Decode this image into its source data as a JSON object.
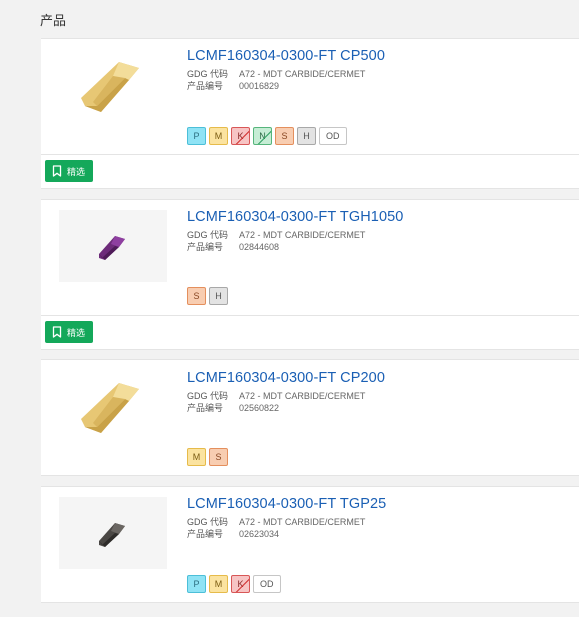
{
  "section": {
    "title": "产品"
  },
  "products": [
    {
      "title": "LCMF160304-0300-FT CP500",
      "gdc_label": "GDG 代码",
      "gdc_value": "A72 - MDT CARBIDE/CERMET",
      "id_label": "产品编号",
      "id_value": "00016829",
      "image": "gold-grooving-insert",
      "badges": [
        {
          "code": "P",
          "slash": false
        },
        {
          "code": "M",
          "slash": false
        },
        {
          "code": "K",
          "slash": true
        },
        {
          "code": "N",
          "slash": true
        },
        {
          "code": "S",
          "slash": false
        },
        {
          "code": "H",
          "slash": false
        },
        {
          "code": "OD",
          "slash": false
        }
      ]
    },
    {
      "title": "LCMF160304-0300-FT TGH1050",
      "gdc_label": "GDG 代码",
      "gdc_value": "A72 - MDT CARBIDE/CERMET",
      "id_label": "产品编号",
      "id_value": "02844608",
      "image": "purple-grooving-insert",
      "badges": [
        {
          "code": "S",
          "slash": false
        },
        {
          "code": "H",
          "slash": false
        }
      ]
    },
    {
      "title": "LCMF160304-0300-FT CP200",
      "gdc_label": "GDG 代码",
      "gdc_value": "A72 - MDT CARBIDE/CERMET",
      "id_label": "产品编号",
      "id_value": "02560822",
      "image": "gold-grooving-insert",
      "badges": [
        {
          "code": "M",
          "slash": false
        },
        {
          "code": "S",
          "slash": false
        }
      ]
    },
    {
      "title": "LCMF160304-0300-FT TGP25",
      "gdc_label": "GDG 代码",
      "gdc_value": "A72 - MDT CARBIDE/CERMET",
      "id_label": "产品编号",
      "id_value": "02623034",
      "image": "dark-grooving-insert",
      "badges": [
        {
          "code": "P",
          "slash": false
        },
        {
          "code": "M",
          "slash": false
        },
        {
          "code": "K",
          "slash": true
        },
        {
          "code": "OD",
          "slash": false
        }
      ]
    }
  ],
  "filter_button": {
    "label": "精选",
    "icon": "bookmark-icon"
  },
  "colors": {
    "link": "#1a5fb4",
    "filter_green": "#14a85a",
    "page_bg": "#f2f2f2"
  }
}
